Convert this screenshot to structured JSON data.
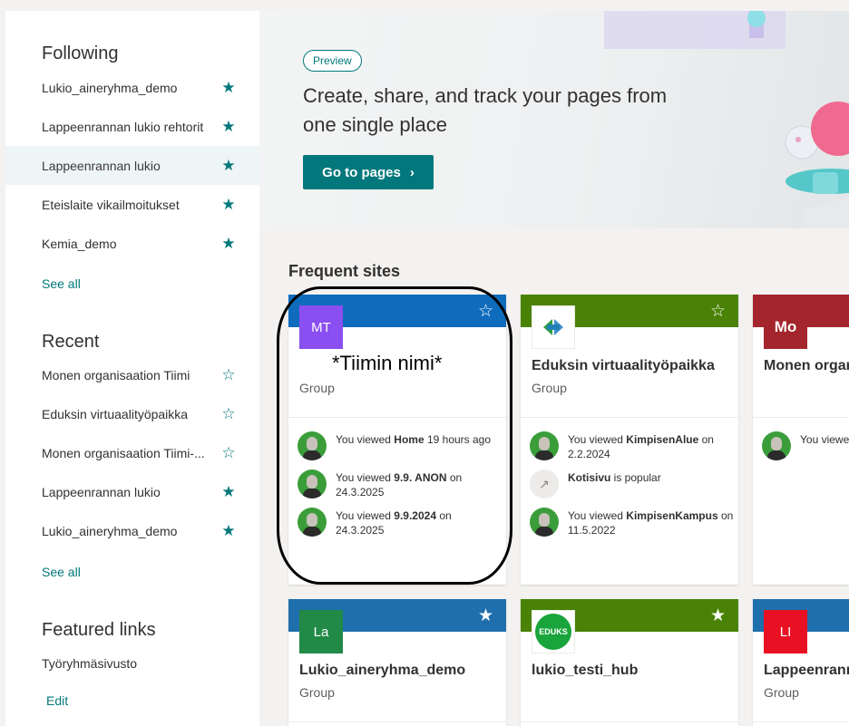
{
  "sidebar": {
    "following": {
      "title": "Following",
      "items": [
        {
          "label": "Lukio_aineryhma_demo",
          "starred": true
        },
        {
          "label": "Lappeenrannan lukio rehtorit",
          "starred": true
        },
        {
          "label": "Lappeenrannan lukio",
          "starred": true,
          "selected": true
        },
        {
          "label": "Eteislaite vikailmoitukset",
          "starred": true
        },
        {
          "label": "Kemia_demo",
          "starred": true
        }
      ],
      "see_all": "See all"
    },
    "recent": {
      "title": "Recent",
      "items": [
        {
          "label": "Monen organisaation Tiimi",
          "starred": false
        },
        {
          "label": "Eduksin virtuaalityöpaikka",
          "starred": false
        },
        {
          "label": "Monen organisaation Tiimi-...",
          "starred": false
        },
        {
          "label": "Lappeenrannan lukio",
          "starred": true
        },
        {
          "label": "Lukio_aineryhma_demo",
          "starred": true
        }
      ],
      "see_all": "See all"
    },
    "featured": {
      "title": "Featured links",
      "item": "Työryhmäsivusto",
      "edit": "Edit"
    }
  },
  "hero": {
    "pill": "Preview",
    "title": "Create, share, and track your pages from one single place",
    "button": "Go to pages",
    "button_icon": "chevron-right-icon"
  },
  "frequent": {
    "title": "Frequent sites",
    "cards": [
      {
        "color": "#0f6cbd",
        "logo": "MT",
        "logo_color": "#8a4ff0",
        "name": "",
        "type": "Group",
        "activity": [
          {
            "pre": "You viewed ",
            "bold": "Home",
            "post": " 19 hours ago"
          },
          {
            "pre": "You viewed ",
            "bold": "9.9. ANON",
            "post": " on 24.3.2025"
          },
          {
            "pre": "You viewed ",
            "bold": "9.9.2024",
            "post": " on 24.3.2025"
          }
        ]
      },
      {
        "color": "#498205",
        "logo": "",
        "logo_color": "#ffffff",
        "name": "Eduksin virtuaalityöpaikka",
        "type": "Group",
        "activity": [
          {
            "pre": "You viewed ",
            "bold": "KimpisenAlue",
            "post": " on 2.2.2024"
          },
          {
            "pre": "",
            "bold": "Kotisivu",
            "post": " is popular"
          },
          {
            "pre": "You viewed ",
            "bold": "KimpisenKampus",
            "post": " on 11.5.2022"
          }
        ]
      },
      {
        "color": "#a4262c",
        "logo": "Mo",
        "logo_color": "#a4262c",
        "name": "Monen organ Jakokannu",
        "type": "",
        "activity": [
          {
            "pre": "You viewe",
            "bold": "",
            "post": ""
          }
        ]
      },
      {
        "color": "#1f6fad",
        "logo": "La",
        "logo_color": "#218a47",
        "name": "Lukio_aineryhma_demo",
        "type": "Group",
        "activity": []
      },
      {
        "color": "#498205",
        "logo": "EDUKS",
        "logo_color": "#ffffff",
        "name": "lukio_testi_hub",
        "type": "",
        "activity": []
      },
      {
        "color": "#1f6fad",
        "logo": "LI",
        "logo_color": "#e81123",
        "name": "Lappeenrann",
        "type": "Group",
        "activity": []
      }
    ]
  },
  "annotation": "*Tiimin nimi*"
}
